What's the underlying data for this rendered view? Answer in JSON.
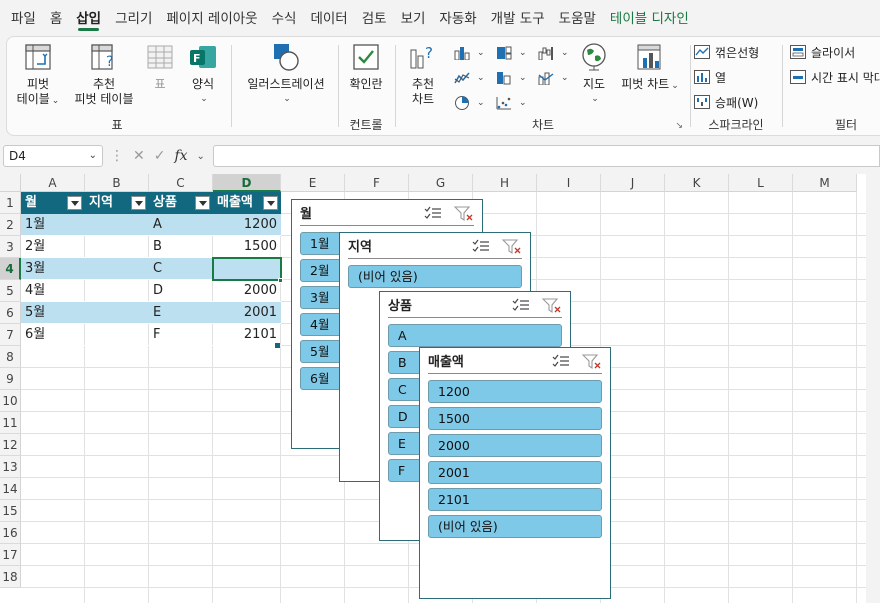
{
  "tabs": [
    "파일",
    "홈",
    "삽입",
    "그리기",
    "페이지 레이아웃",
    "수식",
    "데이터",
    "검토",
    "보기",
    "자동화",
    "개발 도구",
    "도움말",
    "테이블 디자인"
  ],
  "ribbon": {
    "pivot_table": {
      "line1": "피벗",
      "line2": "테이블"
    },
    "recommended_pivot": {
      "line1": "추천",
      "line2": "피벗 테이블"
    },
    "table": "표",
    "forms": "양식",
    "group_table": "표",
    "illustrations": "일러스트레이션",
    "checkbox": "확인란",
    "group_controls": "컨트롤",
    "recommended_charts": {
      "line1": "추천",
      "line2": "차트"
    },
    "maps": "지도",
    "pivot_chart": "피벗 차트",
    "group_charts": "차트",
    "sparkline_line": "꺾은선형",
    "sparkline_column": "열",
    "sparkline_winloss": "승패(W)",
    "group_sparklines": "스파크라인",
    "slicer": "슬라이서",
    "timeline": "시간 표시 막대",
    "group_filters": "필터"
  },
  "formula_bar": {
    "name_box": "D4",
    "fx": "fx",
    "formula": ""
  },
  "columns": [
    "A",
    "B",
    "C",
    "D",
    "E",
    "F",
    "G",
    "H",
    "I",
    "J",
    "K",
    "L",
    "M"
  ],
  "rows": [
    "1",
    "2",
    "3",
    "4",
    "5",
    "6",
    "7",
    "8",
    "9",
    "10",
    "11",
    "12",
    "13",
    "14",
    "15",
    "16",
    "17",
    "18"
  ],
  "table": {
    "headers": [
      "월",
      "지역",
      "상품",
      "매출액"
    ],
    "rows": [
      [
        "1월",
        "",
        "A",
        "1200"
      ],
      [
        "2월",
        "",
        "B",
        "1500"
      ],
      [
        "3월",
        "",
        "C",
        ""
      ],
      [
        "4월",
        "",
        "D",
        "2000"
      ],
      [
        "5월",
        "",
        "E",
        "2001"
      ],
      [
        "6월",
        "",
        "F",
        "2101"
      ]
    ]
  },
  "slicers": {
    "month": {
      "title": "월",
      "items": [
        "1월",
        "2월",
        "3월",
        "4월",
        "5월",
        "6월"
      ]
    },
    "region": {
      "title": "지역",
      "items": [
        "(비어 있음)"
      ]
    },
    "product": {
      "title": "상품",
      "items": [
        "A",
        "B",
        "C",
        "D",
        "E",
        "F"
      ]
    },
    "sales": {
      "title": "매출액",
      "items": [
        "1200",
        "1500",
        "2000",
        "2001",
        "2101",
        "(비어 있음)"
      ]
    }
  }
}
